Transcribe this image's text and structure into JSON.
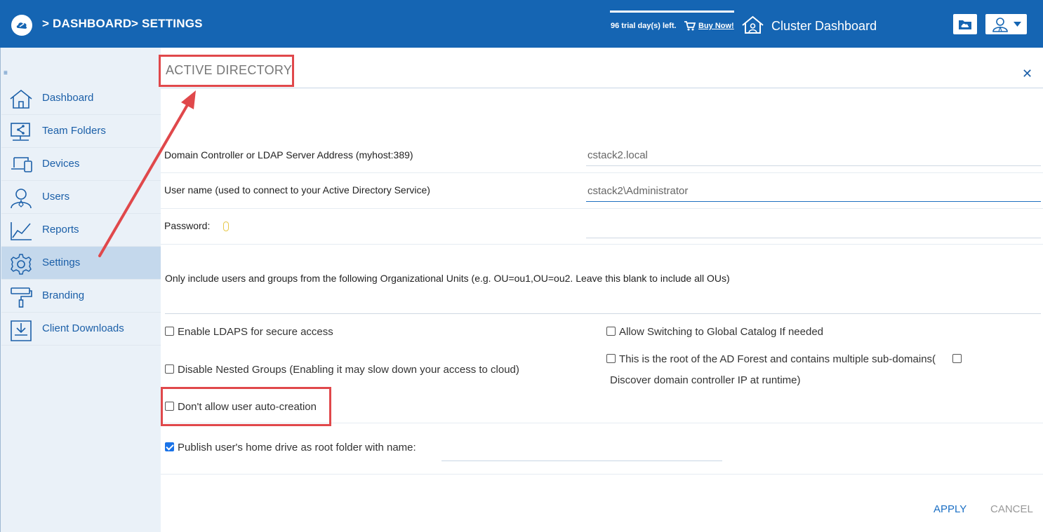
{
  "header": {
    "breadcrumb": [
      {
        "label": "> DASHBOARD"
      },
      {
        "label": "> SETTINGS"
      }
    ],
    "trial_text": "96 trial day(s) left.",
    "buy_now": "Buy Now!",
    "cluster_dashboard": "Cluster Dashboard"
  },
  "sidebar": {
    "items": [
      {
        "label": "Dashboard",
        "icon": "home-icon"
      },
      {
        "label": "Team Folders",
        "icon": "team-folders-icon"
      },
      {
        "label": "Devices",
        "icon": "devices-icon"
      },
      {
        "label": "Users",
        "icon": "users-icon"
      },
      {
        "label": "Reports",
        "icon": "reports-icon"
      },
      {
        "label": "Settings",
        "icon": "gear-icon",
        "active": true
      },
      {
        "label": "Branding",
        "icon": "paint-roller-icon"
      },
      {
        "label": "Client Downloads",
        "icon": "download-icon"
      }
    ]
  },
  "main": {
    "title": "ACTIVE DIRECTORY",
    "fields": {
      "server_label": "Domain Controller or LDAP Server Address (myhost:389)",
      "server_value": "cstack2.local",
      "username_label": "User name (used to connect to your Active Directory Service)",
      "username_value": "cstack2\\Administrator",
      "password_label": "Password:",
      "password_value": "",
      "ou_label": "Only include users and groups from the following Organizational Units (e.g. OU=ou1,OU=ou2. Leave this blank to include all OUs)",
      "ou_value": "",
      "home_drive_name_value": ""
    },
    "options": {
      "enable_ldaps": {
        "label": "Enable LDAPS for secure access",
        "checked": false
      },
      "allow_global_catalog": {
        "label": "Allow Switching to Global Catalog If needed",
        "checked": false
      },
      "disable_nested_groups": {
        "label": "Disable Nested Groups (Enabling it may slow down your access to cloud)",
        "checked": false
      },
      "root_ad_forest": {
        "label": "This is the root of the AD Forest and contains multiple sub-domains(",
        "checked": false
      },
      "discover_dc_ip": {
        "label": "Discover domain controller IP at runtime)",
        "checked": false
      },
      "dont_allow_auto_creation": {
        "label": "Don't allow user auto-creation",
        "checked": false
      },
      "publish_home_drive": {
        "label": "Publish user's home drive as root folder with name:",
        "checked": true
      }
    },
    "actions": {
      "apply": "APPLY",
      "cancel": "CANCEL"
    }
  },
  "colors": {
    "header_bg": "#1565b3",
    "sidebar_bg": "#eaf1f8",
    "active_nav_bg": "#c4d8ec",
    "accent": "#1b6fc4",
    "annotation": "#e0484b"
  }
}
